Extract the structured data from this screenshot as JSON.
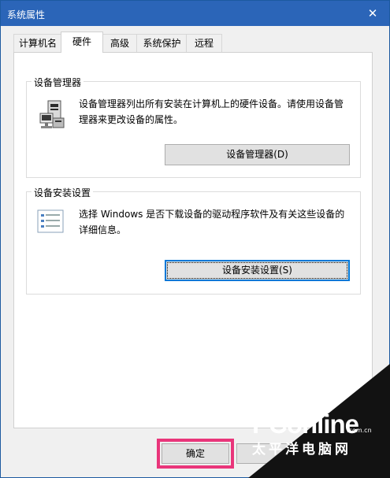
{
  "window": {
    "title": "系统属性"
  },
  "tabs": [
    {
      "label": "计算机名"
    },
    {
      "label": "硬件",
      "active": true
    },
    {
      "label": "高级"
    },
    {
      "label": "系统保护"
    },
    {
      "label": "远程"
    }
  ],
  "device_manager": {
    "group_title": "设备管理器",
    "description": "设备管理器列出所有安装在计算机上的硬件设备。请使用设备管理器来更改设备的属性。",
    "button_label": "设备管理器(D)",
    "icon": "device-manager-icon"
  },
  "device_install": {
    "group_title": "设备安装设置",
    "description": "选择 Windows 是否下载设备的驱动程序软件及有关这些设备的详细信息。",
    "button_label": "设备安装设置(S)",
    "icon": "settings-list-icon"
  },
  "footer": {
    "ok_label": "确定"
  },
  "watermark": {
    "brand": "PConline",
    "domain": ".com.cn",
    "cn": "太平洋电脑网"
  },
  "colors": {
    "titlebar": "#2b65b8",
    "highlight": "#e9357a",
    "focus": "#0078d7"
  }
}
